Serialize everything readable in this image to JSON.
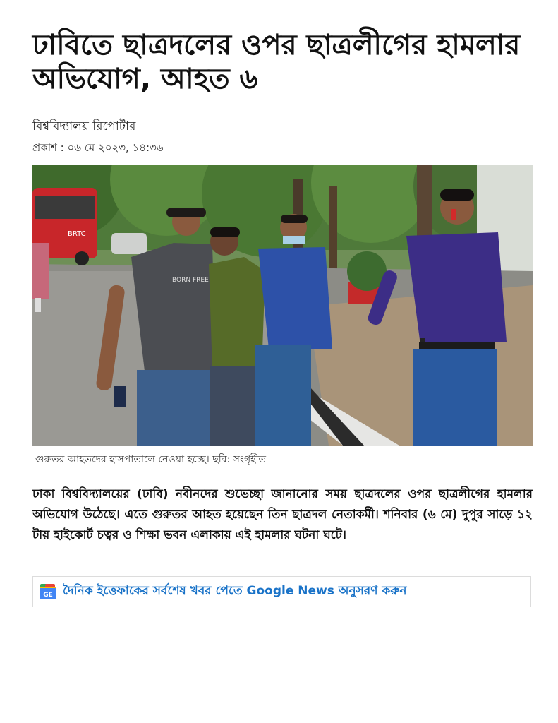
{
  "article": {
    "headline": "ঢাবিতে ছাত্রদলের ওপর ছাত্রলীগের হামলার অভিযোগ, আহত ৬",
    "byline": "বিশ্ববিদ্যালয় রিপোর্টার",
    "published": "প্রকাশ : ০৬ মে ২০২৩, ১৪:৩৬",
    "photo_caption": "গুরুতর আহতদের হাসপাতালে নেওয়া হচ্ছে। ছবি: সংগৃহীত",
    "body": "ঢাকা বিশ্ববিদ্যালয়ের (ঢাবি) নবীনদের শুভেচ্ছা জানানোর সময় ছাত্রদলের ওপর ছাত্রলীগের হামলার অভিযোগ উঠেছে। এতে গুরুতর আহত হয়েছেন তিন ছাত্রদল নেতাকর্মী। শনিবার (৬ মে) দুপুর সাড়ে ১২ টায় হাইকোর্ট চত্বর ও শিক্ষা ভবন এলাকায় এই হামলার ঘটনা ঘটে।"
  },
  "photo": {
    "bus_label": "BRTC",
    "shirt_text": "BORN FREE"
  },
  "follow": {
    "icon": "google-news-icon",
    "icon_text": "GE",
    "text": "দৈনিক ইত্তেফাকের সর্বশেষ খবর পেতে Google News অনুসরণ করুন"
  },
  "colors": {
    "link": "#1a73c8",
    "border": "#dcdcdc"
  }
}
